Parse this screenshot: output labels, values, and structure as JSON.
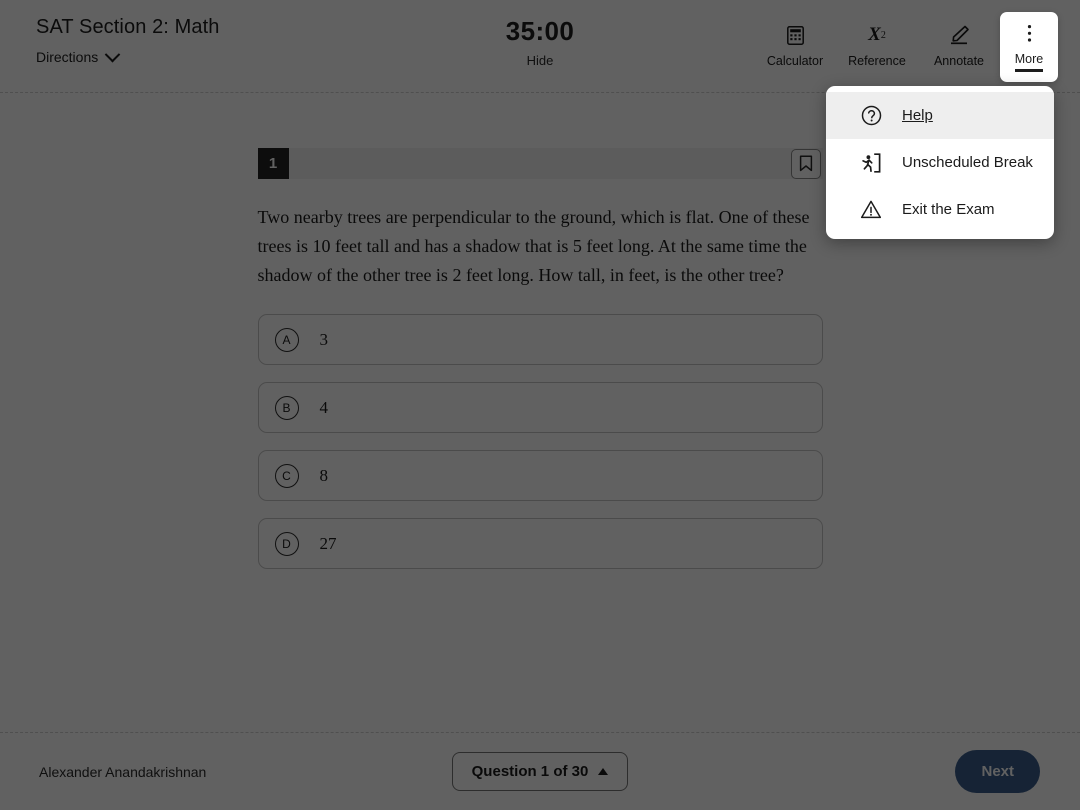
{
  "header": {
    "exam_title": "SAT Section 2: Math",
    "directions_label": "Directions",
    "directions_icon": "chevron-down-icon",
    "timer": "35:00",
    "timer_toggle_label": "Hide",
    "tools": [
      {
        "label": "Calculator",
        "icon": "calculator-icon"
      },
      {
        "label": "Reference",
        "icon": "reference-x-squared-icon"
      },
      {
        "label": "Annotate",
        "icon": "highlighter-pencil-icon"
      },
      {
        "label": "More",
        "icon": "vertical-dots-icon"
      }
    ]
  },
  "more_menu": {
    "items": [
      {
        "label": "Help",
        "icon": "question-mark-circle-icon",
        "hovered": true
      },
      {
        "label": "Unscheduled Break",
        "icon": "running-person-exit-icon",
        "hovered": false
      },
      {
        "label": "Exit the Exam",
        "icon": "warning-triangle-icon",
        "hovered": false
      }
    ]
  },
  "question": {
    "number": "1",
    "bookmark_icon": "bookmark-icon",
    "text": "Two nearby trees are perpendicular to the ground, which is flat. One of these trees is 10 feet tall and has a shadow that is 5 feet long. At the same time the shadow of the other tree is 2 feet long. How tall, in feet, is the other tree?",
    "choices": [
      {
        "letter": "A",
        "text": "3"
      },
      {
        "letter": "B",
        "text": "4"
      },
      {
        "letter": "C",
        "text": "8"
      },
      {
        "letter": "D",
        "text": "27"
      }
    ]
  },
  "footer": {
    "student_name": "Alexander Anandakrishnan",
    "question_nav_label": "Question 1 of 30",
    "question_nav_icon": "caret-up-icon",
    "next_label": "Next"
  },
  "colors": {
    "next_button": "#3a5e8c",
    "question_badge": "#222222",
    "menu_hover": "#eeeeee",
    "scrim": "rgba(0,0,0,0.62)"
  }
}
